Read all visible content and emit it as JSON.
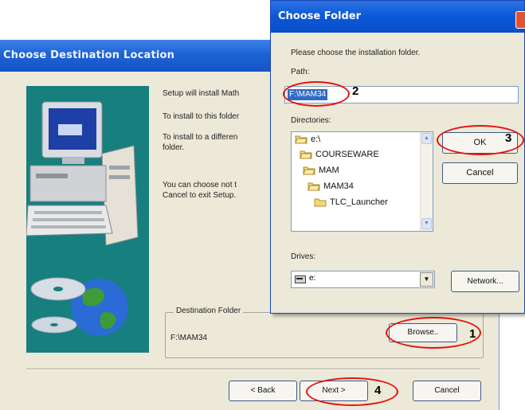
{
  "back_window": {
    "title": "Choose Destination Location",
    "paragraphs": [
      "Setup will install Math",
      "To install to this folder",
      "To install to a differen\nfolder.",
      "You can choose not t\nCancel to exit Setup."
    ],
    "destination_group_label": "Destination Folder",
    "destination_path": "F:\\MAM34",
    "browse_label": "Browse..",
    "back_label": "< Back",
    "next_label": "Next >",
    "cancel_label": "Cancel"
  },
  "dialog": {
    "title": "Choose Folder",
    "prompt": "Please choose the installation folder.",
    "path_label": "Path:",
    "path_value": "F:\\MAM34",
    "directories_label": "Directories:",
    "directories": [
      "e:\\",
      "COURSEWARE",
      "MAM",
      "MAM34",
      "TLC_Launcher"
    ],
    "ok_label": "OK",
    "cancel_label": "Cancel",
    "drives_label": "Drives:",
    "drive_value": "e:",
    "network_label": "Network..."
  },
  "step_markers": {
    "browse": "1",
    "path": "2",
    "ok": "3",
    "next": "4"
  },
  "icons": {
    "hero": "computer-with-cds-and-globe-illustration",
    "close": "close-icon",
    "folder": "folder-icon",
    "drive": "drive-icon"
  },
  "colors": {
    "title_bar": "#0a4fc9",
    "dialog_bg": "#ece9d8",
    "hero_bg": "#177f7d",
    "annotation_ring": "#e5120f",
    "selection": "#316ac5"
  }
}
